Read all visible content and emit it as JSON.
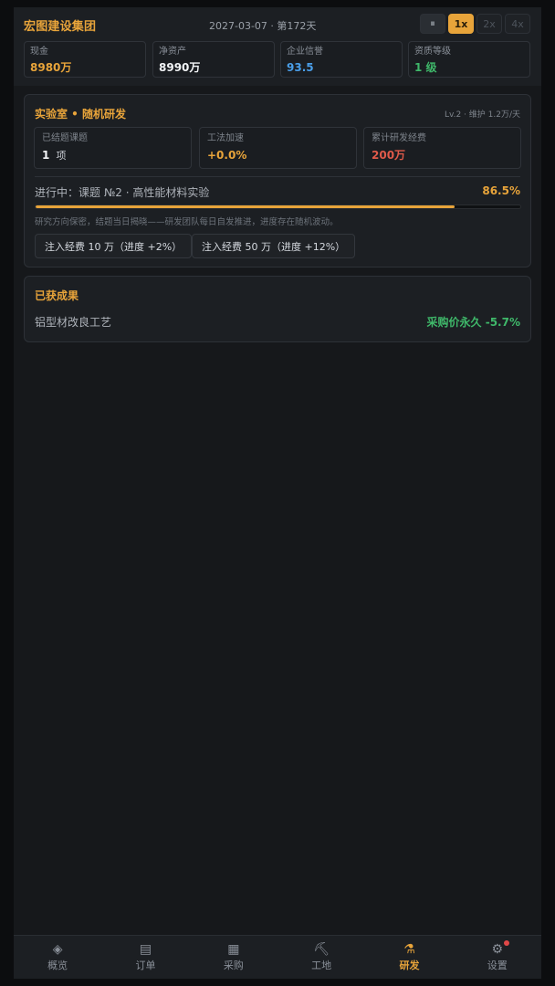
{
  "header": {
    "company": "宏图建设集团",
    "date": "2027-03-07 · 第172天",
    "speed": {
      "pause_icon": "pause-icon",
      "pause_glyph": "⏸",
      "options": [
        "1x",
        "2x",
        "4x"
      ],
      "active": "1x"
    },
    "stats": [
      {
        "label": "现金",
        "value": "8980万",
        "color": "#e8a43a"
      },
      {
        "label": "净资产",
        "value": "8990万",
        "color": "#f2f4f6"
      },
      {
        "label": "企业信誉",
        "value": "93.5",
        "color": "#4a9ee8"
      },
      {
        "label": "资质等级",
        "value": "1 级",
        "color": "#3fb86a"
      }
    ]
  },
  "lab": {
    "title": "实验室 • 随机研发",
    "meta": "Lv.2 · 维护 1.2万/天",
    "cards": [
      {
        "label": "已结题课题",
        "value": "1",
        "unit": "项",
        "color": "#f2f4f6"
      },
      {
        "label": "工法加速",
        "value": "+0.0%",
        "color": "#e8a43a"
      },
      {
        "label": "累计研发经费",
        "value": "200万",
        "color": "#e05a4a"
      }
    ],
    "progress_label": "进行中：课题 №2 · 高性能材料实验",
    "progress_percent": 86.5,
    "progress_text": "86.5%",
    "note": "研究方向保密，结题当日揭晓——研发团队每日自发推进，进度存在随机波动。",
    "buttons": [
      "注入经费 10 万（进度 +2%）",
      "注入经费 50 万（进度 +12%）"
    ]
  },
  "achievements": {
    "title": "已获成果",
    "items": [
      {
        "name": "铝型材改良工艺",
        "effect": "采购价永久 -5.7%"
      }
    ]
  },
  "nav": {
    "items": [
      {
        "label": "概览",
        "icon": "diamond-icon",
        "glyph": "◈"
      },
      {
        "label": "订单",
        "icon": "list-icon",
        "glyph": "▤"
      },
      {
        "label": "采购",
        "icon": "grid-icon",
        "glyph": "▦"
      },
      {
        "label": "工地",
        "icon": "pickaxe-icon",
        "glyph": "⛏"
      },
      {
        "label": "研发",
        "icon": "flask-icon",
        "glyph": "⚗"
      },
      {
        "label": "设置",
        "icon": "gear-icon",
        "glyph": "⚙"
      }
    ],
    "active": "研发"
  }
}
